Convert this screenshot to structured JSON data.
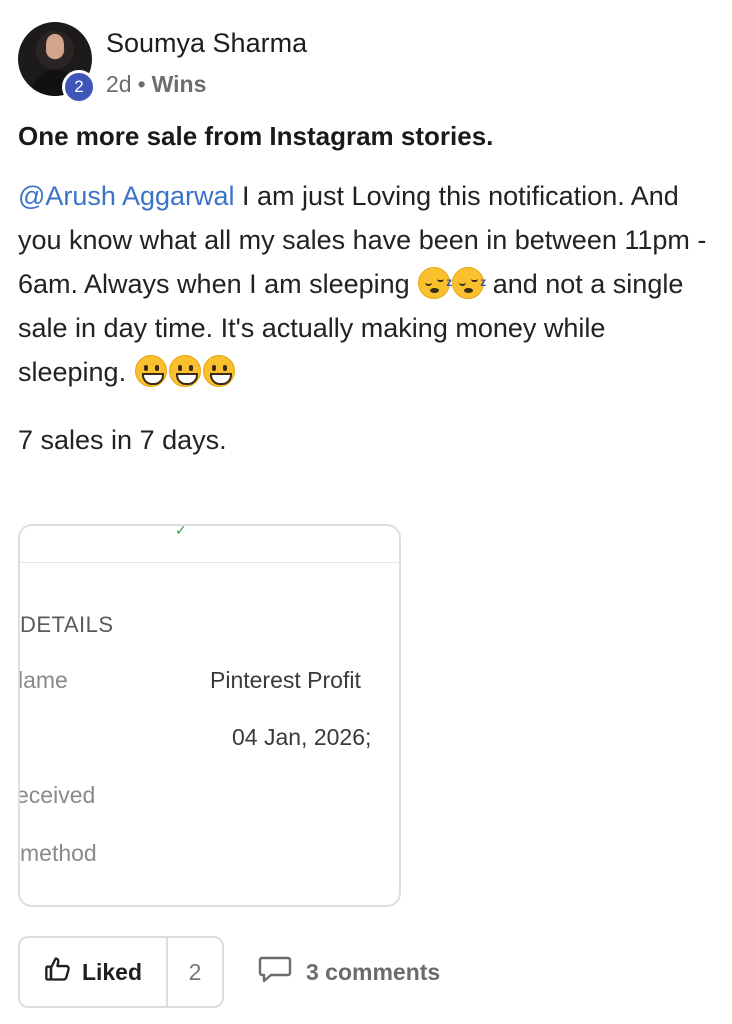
{
  "author": {
    "name": "Soumya Sharma",
    "level": "2",
    "time": "2d",
    "separator": "•",
    "category": "Wins"
  },
  "post": {
    "title": "One more sale from Instagram stories.",
    "mention": "@Arush Aggarwal",
    "body_1": " I am just Loving this notification. And you know what all my sales have been in between 11pm - 6am. Always when I am sleeping ",
    "body_2": " and not a single sale in day time. It's actually making money while sleeping. ",
    "sales_line": "7 sales in 7 days."
  },
  "attachment": {
    "heading": "DETAILS",
    "rows": [
      {
        "label": "lame",
        "value": "Pinterest Profit"
      },
      {
        "label": "",
        "value": "04 Jan, 2026;"
      },
      {
        "label": "eceived",
        "value": ""
      },
      {
        "label": "method",
        "value": ""
      }
    ]
  },
  "actions": {
    "like_label": "Liked",
    "like_count": "2",
    "comments_label": "3 comments"
  },
  "icons": {
    "like": "thumbs-up-icon",
    "comment": "comment-bubble-icon",
    "emoji_sleep": "sleeping-face-emoji",
    "emoji_grin": "grinning-face-emoji"
  },
  "colors": {
    "mention": "#3b73c8",
    "badge": "#3f55b8"
  }
}
